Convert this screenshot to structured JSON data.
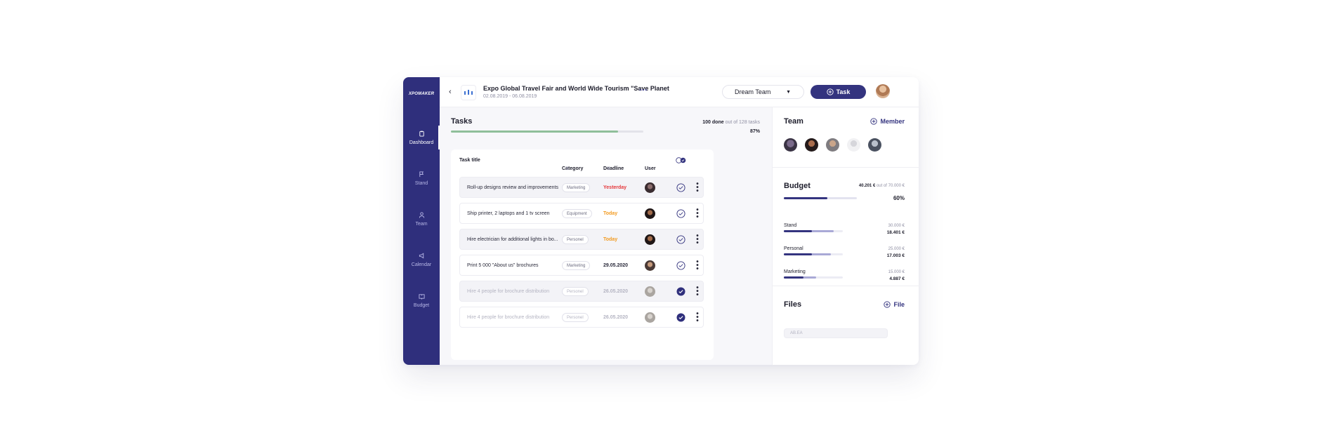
{
  "sidebar": {
    "logo": "XPOMAKER",
    "items": [
      {
        "label": "Dashboard",
        "icon": "clipboard-icon",
        "active": true
      },
      {
        "label": "Stand",
        "icon": "flag-icon",
        "active": false
      },
      {
        "label": "Team",
        "icon": "user-icon",
        "active": false
      },
      {
        "label": "Calendar",
        "icon": "megaphone-icon",
        "active": false
      },
      {
        "label": "Budget",
        "icon": "book-icon",
        "active": false
      }
    ]
  },
  "header": {
    "event_title": "Expo Global Travel Fair and World Wide Tourism \"Save Planet",
    "event_dates": "02.08.2019 - 06.08.2019",
    "more": "...",
    "team_select": "Dream Team",
    "task_button": "Task"
  },
  "tasks": {
    "title": "Tasks",
    "done_count": "100 done",
    "done_suffix": "out of 128 tasks",
    "progress": 0.87,
    "progress_label": "87%",
    "columns": [
      "Task title",
      "Category",
      "Deadline",
      "User"
    ],
    "rows": [
      {
        "title": "Roll-up designs review and improvements",
        "category": "Marketing",
        "deadline": "Yesterday",
        "deadline_color": "#e5383b",
        "done": false,
        "muted": false
      },
      {
        "title": "Ship printer, 2 laptops and 1 tv screen",
        "category": "Equipment",
        "deadline": "Today",
        "deadline_color": "#f29a1f",
        "done": false,
        "muted": false
      },
      {
        "title": "Hire electrician for additional lights in bo...",
        "category": "Personel",
        "deadline": "Today",
        "deadline_color": "#f29a1f",
        "done": false,
        "muted": false
      },
      {
        "title": "Print 5 000 \"About us\" brochures",
        "category": "Marketing",
        "deadline": "29.05.2020",
        "deadline_color": "#2a2a3a",
        "done": false,
        "muted": false
      },
      {
        "title": "Hire 4 people for brochure distribution",
        "category": "Personel",
        "deadline": "26.05.2020",
        "deadline_color": "#b4b4c2",
        "done": true,
        "muted": true
      },
      {
        "title": "Hire 4 people for brochure distribution",
        "category": "Personel",
        "deadline": "26.05.2020",
        "deadline_color": "#b4b4c2",
        "done": true,
        "muted": true
      }
    ]
  },
  "team": {
    "title": "Team",
    "add_label": "Member"
  },
  "budget": {
    "title": "Budget",
    "spent": "40.201 €",
    "total_suffix": "out of 70.000 €",
    "progress": 0.6,
    "progress_label": "60%",
    "items": [
      {
        "label": "Stand",
        "planned": "30.000 €",
        "spent": "18.401 €",
        "planned_fill": 0.85,
        "spent_fill": 0.48
      },
      {
        "label": "Personal",
        "planned": "25.000 €",
        "spent": "17.003 €",
        "planned_fill": 0.8,
        "spent_fill": 0.48
      },
      {
        "label": "Marketing",
        "planned": "15.000 €",
        "spent": "4.887 €",
        "planned_fill": 0.55,
        "spent_fill": 0.33
      }
    ]
  },
  "files": {
    "title": "Files",
    "add_label": "File",
    "first_file": "AB.EA"
  },
  "colors": {
    "brand": "#34347f",
    "sidebar": "#2f2f7c",
    "progress_green": "#8fbf9a",
    "overdue": "#e5383b",
    "today": "#f29a1f"
  }
}
